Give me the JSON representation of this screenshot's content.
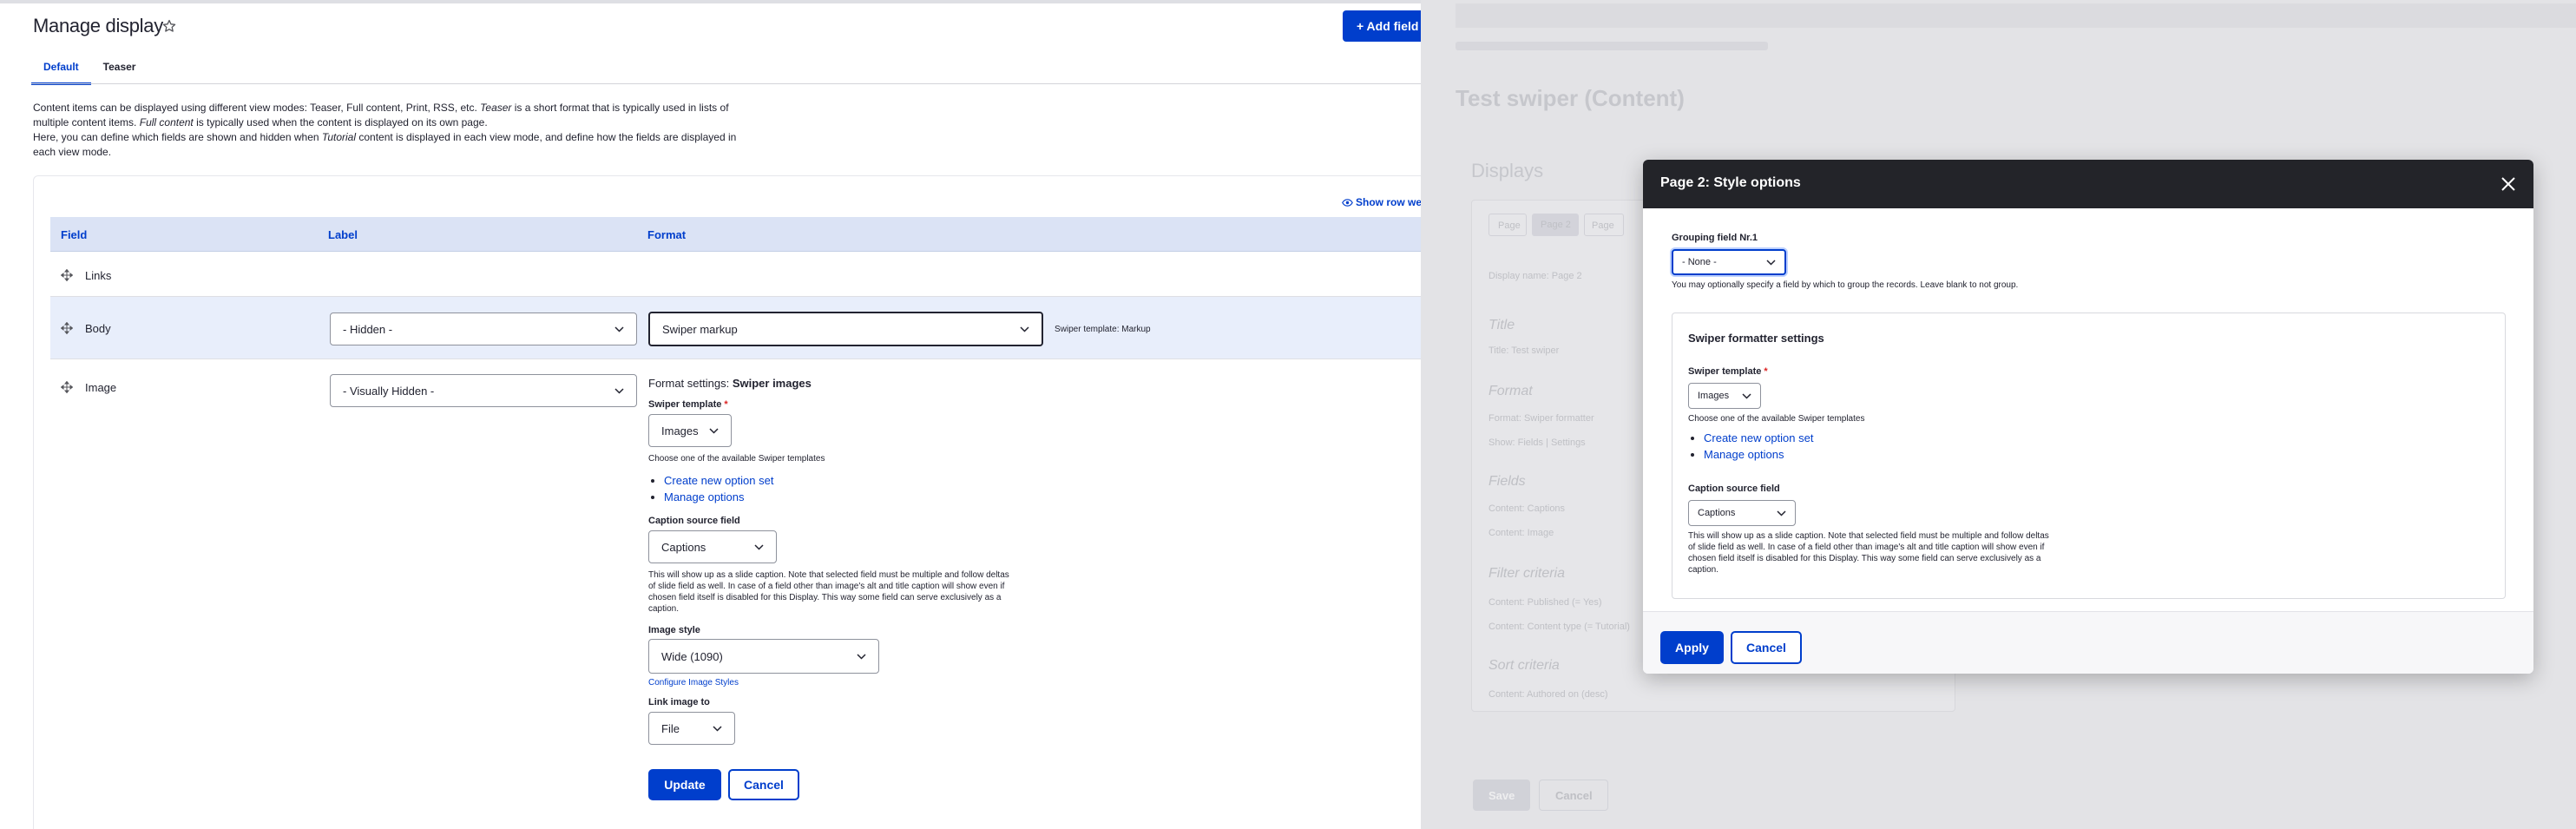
{
  "page": {
    "title": "Manage display",
    "add_field_label": "+ Add field",
    "tabs": [
      "Default",
      "Teaser"
    ],
    "intro_line1_a": "Content items can be displayed using different view modes: Teaser, Full content, Print, RSS, etc.",
    "intro_line1_b": "Teaser",
    "intro_line1_c": "is a short format that is typically used in lists of multiple content items.",
    "intro_line1_d": "Full content",
    "intro_line1_e": "is typically used when the content is displayed on its own page.",
    "intro_line2_a": "Here, you can define which fields are shown and hidden when",
    "intro_line2_b": "Tutorial",
    "intro_line2_c": "content is displayed in each view mode, and define how the fields are displayed in each view mode.",
    "show_row_weights": "Show row wei"
  },
  "table": {
    "headers": [
      "Field",
      "Label",
      "Format"
    ],
    "rows": {
      "links": {
        "name": "Links"
      },
      "body": {
        "name": "Body",
        "label": "- Hidden -",
        "format": "Swiper markup",
        "summary": "Swiper template: Markup"
      },
      "image": {
        "name": "Image",
        "label": "- Visually Hidden -"
      }
    }
  },
  "format_settings": {
    "title_prefix": "Format settings:",
    "title_name": "Swiper images",
    "swiper_template_label": "Swiper template",
    "swiper_template_value": "Images",
    "swiper_template_desc": "Choose one of the available Swiper templates",
    "links": [
      "Create new option set",
      "Manage options"
    ],
    "caption_label": "Caption source field",
    "caption_value": "Captions",
    "caption_desc": "This will show up as a slide caption. Note that selected field must be multiple and follow deltas of slide field as well. In case of a field other than image's alt and title caption will show even if chosen field itself is disabled for this Display. This way some field can serve exclusively as a caption.",
    "image_style_label": "Image style",
    "image_style_value": "Wide (1090)",
    "configure_link": "Configure Image Styles",
    "link_image_label": "Link image to",
    "link_image_value": "File",
    "update_label": "Update",
    "cancel_label": "Cancel"
  },
  "background_view": {
    "title": "Test swiper (Content)",
    "displays": "Displays",
    "tabs": [
      "Page",
      "Page 2",
      "Page"
    ],
    "display_name": "Display name: Page 2",
    "sections": [
      "Title",
      "Format",
      "Fields",
      "Filter criteria",
      "Sort criteria"
    ],
    "title_line": "Title: Test swiper",
    "format_line": "Format: Swiper formatter",
    "show_line": "Show: Fields | Settings",
    "field_lines": [
      "Content: Captions",
      "Content: Image"
    ],
    "filter_lines": [
      "Content: Published (= Yes)",
      "Content: Content type (= Tutorial)"
    ],
    "sort_lines": [
      "Content: Authored on (desc)"
    ],
    "save": "Save",
    "cancel": "Cancel"
  },
  "dialog": {
    "title": "Page 2: Style options",
    "grouping_label": "Grouping field Nr.1",
    "grouping_value": "- None -",
    "grouping_desc": "You may optionally specify a field by which to group the records. Leave blank to not group.",
    "fieldset_title": "Swiper formatter settings",
    "swiper_template_label": "Swiper template",
    "swiper_template_value": "Images",
    "swiper_template_desc": "Choose one of the available Swiper templates",
    "links": [
      "Create new option set",
      "Manage options"
    ],
    "caption_label": "Caption source field",
    "caption_value": "Captions",
    "caption_desc": "This will show up as a slide caption. Note that selected field must be multiple and follow deltas of slide field as well. In case of a field other than image's alt and title caption will show even if chosen field itself is disabled for this Display. This way some field can serve exclusively as a caption.",
    "apply_label": "Apply",
    "cancel_label": "Cancel"
  },
  "colors": {
    "accent": "#003ecc",
    "dialog_header": "#232429",
    "row_highlight": "#e8eefb",
    "required": "#dc2323"
  }
}
